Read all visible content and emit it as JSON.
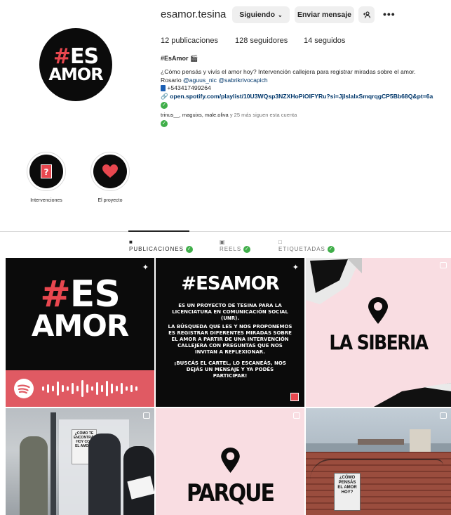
{
  "profile": {
    "username": "esamor.tesina",
    "avatar_logo": {
      "line1": "#ES",
      "line2": "AMOR"
    },
    "buttons": {
      "following": "Siguiendo",
      "message": "Enviar mensaje",
      "suggest_icon": "add-person-icon",
      "more_icon": "more-icon"
    },
    "stats": {
      "posts": "12 publicaciones",
      "followers": "128 seguidores",
      "following": "14 seguidos"
    },
    "bio_name": "#EsAmor 🎬",
    "bio_line1": "¿Cómo pensás y vivís el amor hoy? Intervención callejera para registrar miradas sobre el amor.",
    "bio_line2_prefix": "Rosario",
    "mention1": "@aguus_nic",
    "mention2": "@sabrikrivocapich",
    "phone": "+543417499264",
    "link": "open.spotify.com/playlist/10U3WQsp3NZXHoPiOIFYRu?si=JjIslalxSmqrqgCP5Bb68Q&pt=6a",
    "followed_by_users": "trinus__, maguixs, male.oliva",
    "followed_by_rest": "y 25 más siguen esta cuenta"
  },
  "highlights": [
    {
      "label": "Intervenciones",
      "icon": "question-card-icon"
    },
    {
      "label": "El proyecto",
      "icon": "heart-icon"
    }
  ],
  "tabs": [
    {
      "label": "PUBLICACIONES",
      "icon": "grid-icon",
      "active": true
    },
    {
      "label": "REELS",
      "icon": "reels-icon",
      "active": false
    },
    {
      "label": "ETIQUETADAS",
      "icon": "tagged-icon",
      "active": false
    }
  ],
  "posts": {
    "p1": {
      "line1": "#ES",
      "line2": "AMOR"
    },
    "p2": {
      "title": "#ESAMOR",
      "para1": "ES UN PROYECTO DE TESINA PARA LA LICENCIATURA EN COMUNICACIÓN SOCIAL (UNR).",
      "para2": "LA BÚSQUEDA QUE LES Y NOS PROPONEMOS ES REGISTRAR DIFERENTES MIRADAS SOBRE EL AMOR A PARTIR DE UNA INTERVENCIÓN CALLEJERA CON PREGUNTAS QUE NOS INVITAN A REFLEXIONAR.",
      "para3": "¡BUSCÁS EL CARTEL, LO ESCANEÁS, NOS DEJÁS UN MENSAJE Y YA PODÉS PARTICIPAR!"
    },
    "p3": {
      "place": "LA SIBERIA"
    },
    "p4": {
      "poster": "¿CÓMO TE ENCONTRÁS HOY CON EL AMOR?"
    },
    "p5": {
      "place": "PARQUE"
    },
    "p6": {
      "poster": "¿CÓMO PENSÁS EL AMOR HOY?"
    }
  },
  "colors": {
    "accent_red": "#e8474f",
    "pink_bg": "#f9dde2",
    "link_blue": "#00376b",
    "check_green": "#3fae49"
  }
}
